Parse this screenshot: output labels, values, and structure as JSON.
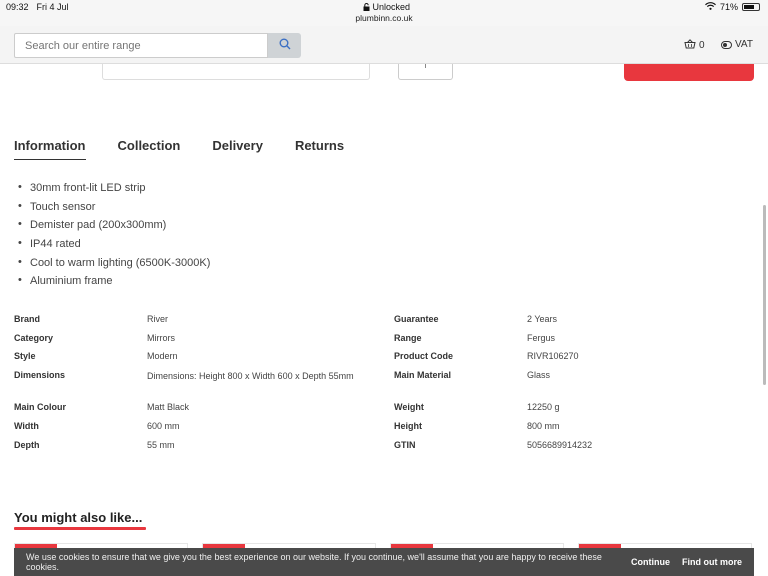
{
  "status_bar": {
    "time": "09:32",
    "date": "Fri 4 Jul",
    "security": "Unlocked",
    "host": "plumbinn.co.uk",
    "battery": "71%",
    "battery_level": 0.71
  },
  "header": {
    "search_placeholder": "Search our entire range",
    "basket_count": "0",
    "vat_label": "VAT"
  },
  "tabs": [
    {
      "label": "Information",
      "active": true
    },
    {
      "label": "Collection",
      "active": false
    },
    {
      "label": "Delivery",
      "active": false
    },
    {
      "label": "Returns",
      "active": false
    }
  ],
  "features": [
    "30mm front-lit LED strip",
    "Touch sensor",
    "Demister pad (200x300mm)",
    "IP44 rated",
    "Cool to warm lighting (6500K-3000K)",
    "Aluminium frame"
  ],
  "specs_left": [
    {
      "label": "Brand",
      "value": "River"
    },
    {
      "label": "Category",
      "value": "Mirrors"
    },
    {
      "label": "Style",
      "value": "Modern"
    },
    {
      "label": "Dimensions",
      "value": "Dimensions: Height 800 x Width 600 x Depth 55mm"
    },
    {
      "label": "Main Colour",
      "value": "Matt Black"
    },
    {
      "label": "Width",
      "value": "600 mm"
    },
    {
      "label": "Depth",
      "value": "55 mm"
    }
  ],
  "specs_right": [
    {
      "label": "Guarantee",
      "value": "2 Years"
    },
    {
      "label": "Range",
      "value": "Fergus"
    },
    {
      "label": "Product Code",
      "value": "RIVR106270"
    },
    {
      "label": "Main Material",
      "value": "Glass"
    },
    {
      "label": "Weight",
      "value": "12250 g"
    },
    {
      "label": "Height",
      "value": "800 mm"
    },
    {
      "label": "GTIN",
      "value": "5056689914232"
    }
  ],
  "recommendations": {
    "title": "You might also like..."
  },
  "cookie_banner": {
    "message": "We use cookies to ensure that we give you the best experience on our website. If you continue, we'll assume that you are happy to receive these cookies.",
    "continue_label": "Continue",
    "find_out_more_label": "Find out more"
  },
  "colors": {
    "accent": "#e8373e",
    "banner": "#4a4a4a"
  }
}
